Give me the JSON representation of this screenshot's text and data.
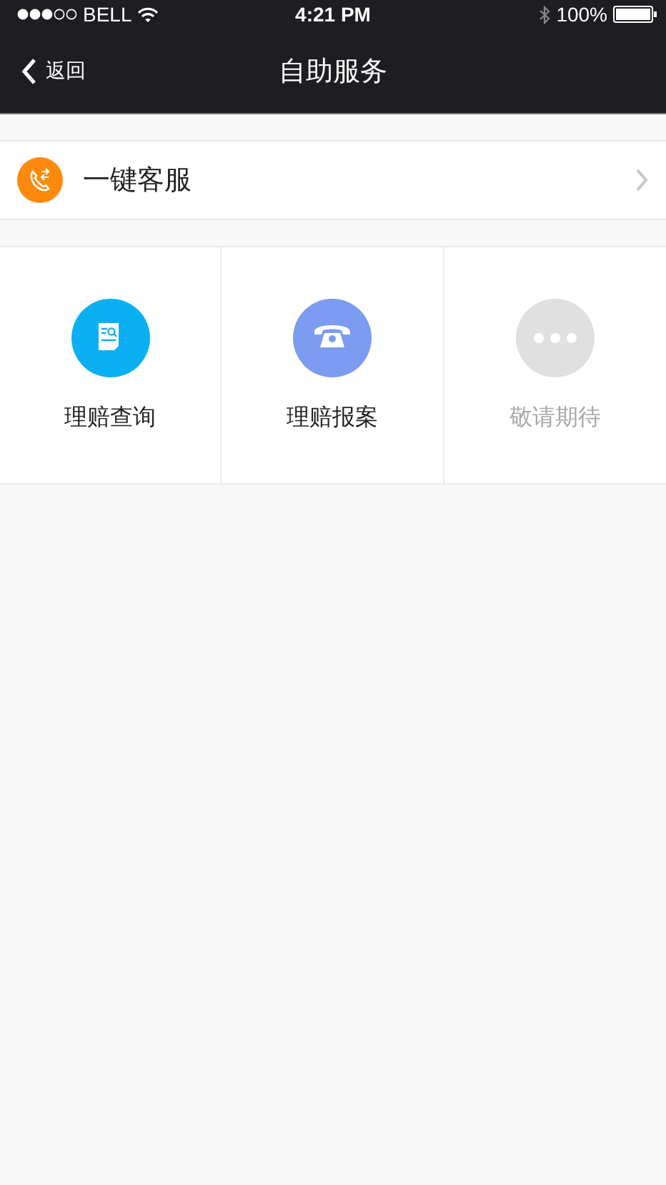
{
  "status_bar": {
    "carrier": "BELL",
    "time": "4:21 PM",
    "battery": "100%"
  },
  "nav": {
    "back": "返回",
    "title": "自助服务"
  },
  "hotline": {
    "label": "一键客服"
  },
  "services": [
    {
      "kind": "document",
      "label": "理赔查询",
      "color": "#0bb0f2",
      "disabled": false
    },
    {
      "kind": "phone",
      "label": "理赔报案",
      "color": "#7b9cf0",
      "disabled": false
    },
    {
      "kind": "more",
      "label": "敬请期待",
      "color": "#e0e0e0",
      "disabled": true
    }
  ]
}
